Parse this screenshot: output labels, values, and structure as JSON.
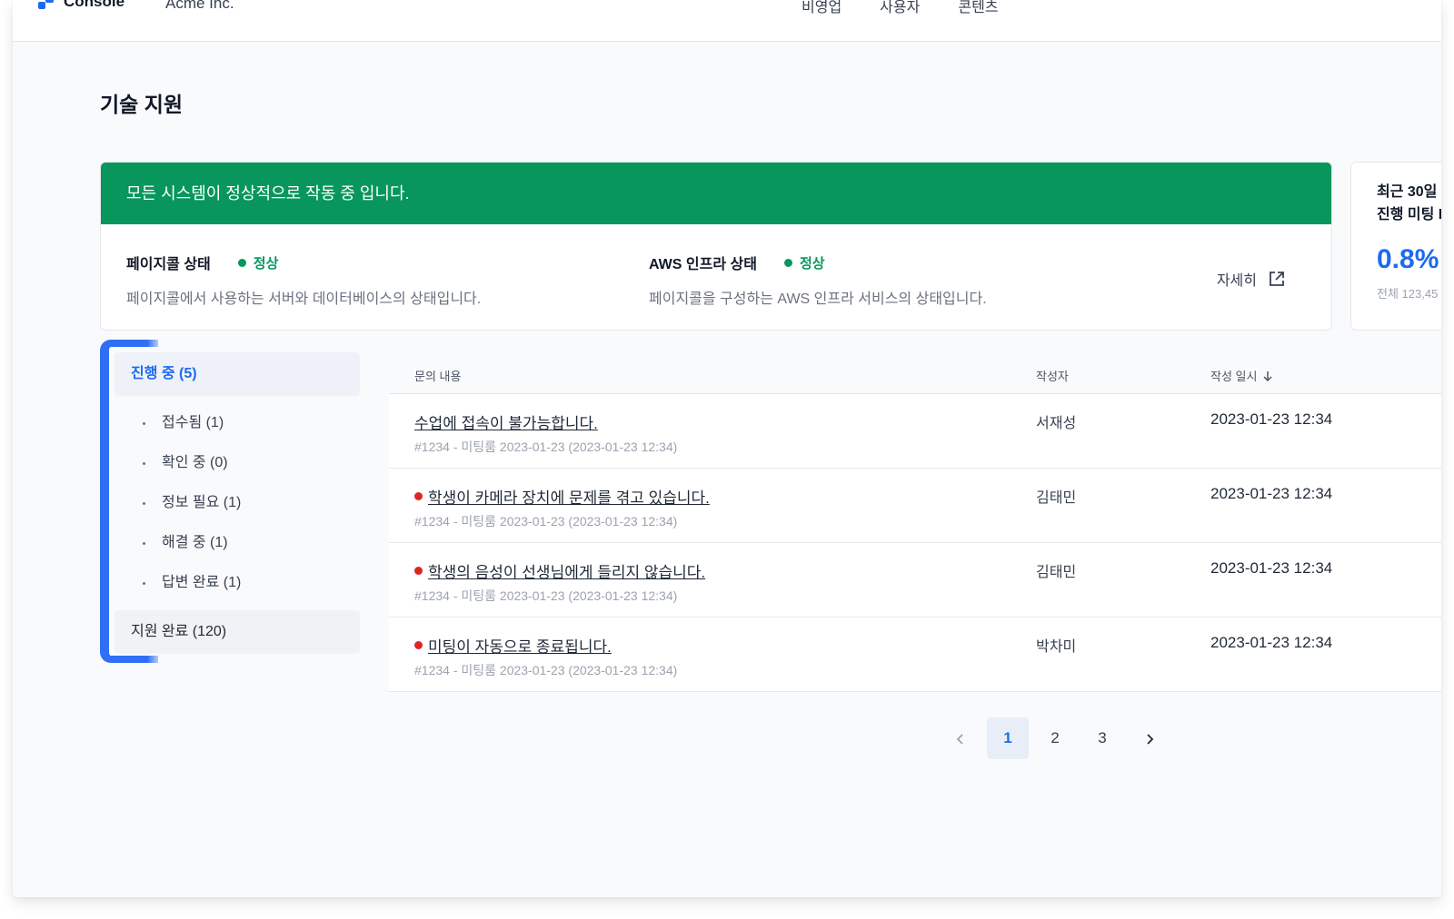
{
  "header": {
    "logo_text": "Console",
    "org": "Acme Inc.",
    "nav": [
      "비영업",
      "사용자",
      "콘텐츠"
    ]
  },
  "page": {
    "title": "기술 지원"
  },
  "status": {
    "banner": "모든 시스템이 정상적으로 작동 중 입니다.",
    "pagecall": {
      "label": "페이지콜 상태",
      "state": "정상",
      "desc": "페이지콜에서 사용하는 서버와 데이터베이스의 상태입니다."
    },
    "aws": {
      "label": "AWS 인프라 상태",
      "state": "정상",
      "desc": "페이지콜을 구성하는 AWS 인프라 서비스의 상태입니다."
    },
    "detail": "자세히"
  },
  "metric": {
    "title_line1": "최근 30일",
    "title_line2": "진행 미팅 I",
    "value": "0.8%",
    "sub": "전체 123,45"
  },
  "sidebar": {
    "active": "진행 중 (5)",
    "items": [
      "접수됨 (1)",
      "확인 중 (0)",
      "정보 필요 (1)",
      "해결 중 (1)",
      "답변 완료 (1)"
    ],
    "done": "지원 완료 (120)"
  },
  "table": {
    "headers": {
      "content": "문의 내용",
      "author": "작성자",
      "date": "작성 일시"
    },
    "rows": [
      {
        "title": "수업에 접속이 불가능합니다.",
        "meta": "#1234 - 미팅룸 2023-01-23 (2023-01-23 12:34)",
        "author": "서재성",
        "date": "2023-01-23 12:34",
        "dot": false
      },
      {
        "title": "학생이 카메라 장치에 문제를 겪고 있습니다.",
        "meta": "#1234 - 미팅룸 2023-01-23 (2023-01-23 12:34)",
        "author": "김태민",
        "date": "2023-01-23 12:34",
        "dot": true
      },
      {
        "title": "학생의 음성이 선생님에게 들리지 않습니다.",
        "meta": "#1234 - 미팅룸 2023-01-23 (2023-01-23 12:34)",
        "author": "김태민",
        "date": "2023-01-23 12:34",
        "dot": true
      },
      {
        "title": "미팅이 자동으로 종료됩니다.",
        "meta": "#1234 - 미팅룸 2023-01-23 (2023-01-23 12:34)",
        "author": "박차미",
        "date": "2023-01-23 12:34",
        "dot": true
      }
    ]
  },
  "pagination": {
    "pages": [
      "1",
      "2",
      "3"
    ],
    "current": "1"
  },
  "colors": {
    "accent": "#1d6af0",
    "success": "#08965c",
    "danger": "#dc2626"
  }
}
